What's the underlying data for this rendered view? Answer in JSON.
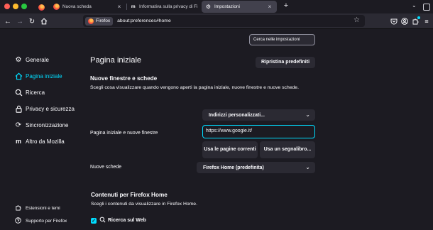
{
  "tabs": [
    {
      "label": "Nuova scheda",
      "active": false
    },
    {
      "label": "Informativa sulla privacy di Firefox",
      "active": false
    },
    {
      "label": "Impostazioni",
      "active": true
    }
  ],
  "new_tab_symbol": "+",
  "urlbar": {
    "identity_label": "Firefox",
    "url": "about:preferences#home"
  },
  "search_placeholder": "Cerca nelle impostazioni",
  "sidebar": {
    "items": [
      {
        "label": "Generale",
        "icon": "gear-icon"
      },
      {
        "label": "Pagina iniziale",
        "icon": "home-icon",
        "selected": true
      },
      {
        "label": "Ricerca",
        "icon": "search-icon"
      },
      {
        "label": "Privacy e sicurezza",
        "icon": "lock-icon"
      },
      {
        "label": "Sincronizzazione",
        "icon": "sync-icon"
      },
      {
        "label": "Altro da Mozilla",
        "icon": "mozilla-icon"
      }
    ],
    "footer": [
      {
        "label": "Estensioni e temi",
        "icon": "puzzle-icon"
      },
      {
        "label": "Supporto per Firefox",
        "icon": "help-icon"
      }
    ]
  },
  "main": {
    "title": "Pagina iniziale",
    "restore_button": "Ripristina predefiniti",
    "section1": {
      "heading": "Nuove finestre e schede",
      "description": "Scegli cosa visualizzare quando vengono aperti la pagina iniziale, nuove finestre e nuove schede."
    },
    "homepage": {
      "label": "Pagina iniziale e nuove finestre",
      "select_value": "Indirizzi personalizzati...",
      "url_value": "https://www.googie.it/",
      "use_current_button": "Usa le pagine correnti",
      "use_bookmark_button": "Usa un segnalibro..."
    },
    "newtabs": {
      "label": "Nuove schede",
      "select_value": "Firefox Home (predefinita)"
    },
    "section2": {
      "heading": "Contenuti per Firefox Home",
      "description": "Scegli i contenuti da visualizzare in Firefox Home.",
      "checkbox_label": "Ricerca sul Web",
      "checked": true
    }
  },
  "colors": {
    "accent": "#00ddff",
    "background": "#1c1b22",
    "toolbar": "#2b2a33"
  }
}
